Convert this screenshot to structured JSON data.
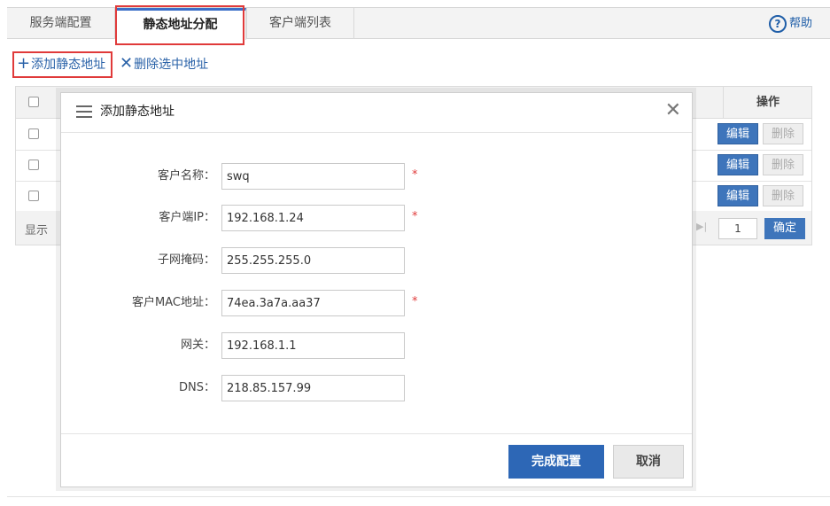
{
  "tabs": [
    {
      "label": "服务端配置"
    },
    {
      "label": "静态地址分配"
    },
    {
      "label": "客户端列表"
    }
  ],
  "help": {
    "label": "帮助"
  },
  "toolbar": {
    "add_label": "添加静态地址",
    "delete_label": "删除选中地址"
  },
  "table": {
    "ops_header": "操作",
    "edit_label": "编辑",
    "delete_label": "删除",
    "footer_show": "显示",
    "page_value": "1",
    "confirm_label": "确定"
  },
  "modal": {
    "title": "添加静态地址",
    "fields": [
      {
        "label": "客户名称：",
        "value": "swq",
        "required": "*"
      },
      {
        "label": "客户端IP：",
        "value": "192.168.1.24",
        "required": "*"
      },
      {
        "label": "子网掩码：",
        "value": "255.255.255.0",
        "required": ""
      },
      {
        "label": "客户MAC地址：",
        "value": "74ea.3a7a.aa37",
        "required": "*"
      },
      {
        "label": "网关：",
        "value": "192.168.1.1",
        "required": ""
      },
      {
        "label": "DNS：",
        "value": "218.85.157.99",
        "required": ""
      }
    ],
    "finish_label": "完成配置",
    "cancel_label": "取消"
  }
}
